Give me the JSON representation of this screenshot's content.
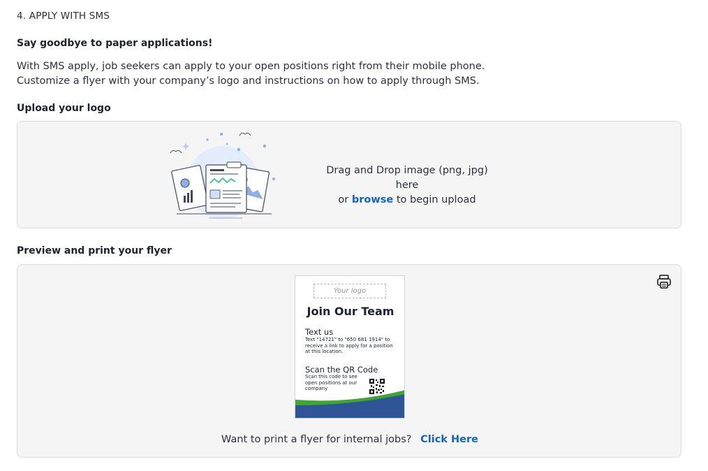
{
  "section_title": "4. APPLY WITH SMS",
  "tagline": "Say goodbye to paper applications!",
  "description": {
    "line1": "With SMS apply, job seekers can apply to your open positions right from their mobile phone.",
    "line2": "Customize a flyer with your company’s logo and instructions on how to apply through SMS."
  },
  "upload": {
    "label": "Upload your logo",
    "line1": "Drag and Drop image (png, jpg) here",
    "or_text": "or",
    "browse": "browse",
    "suffix": "to begin upload"
  },
  "preview": {
    "label": "Preview and print your flyer",
    "print_icon": "printer-icon",
    "flyer": {
      "logo_placeholder": "Your logo",
      "heading": "Join Our Team",
      "text_us_heading": "Text us",
      "text_us_body": "Text \"14721\" to \"650 681 1914\" to receive a link to apply for a position at this location.",
      "scan_heading": "Scan the QR Code",
      "scan_body": "Scan this code to see open positions at our company",
      "colors": {
        "green": "#3fa535",
        "blue": "#2f5597"
      }
    },
    "internal_text": "Want to print a flyer for internal jobs?",
    "click_here": "Click Here"
  },
  "colors": {
    "link": "#1565c0",
    "panel_bg": "#f5f5f5"
  }
}
